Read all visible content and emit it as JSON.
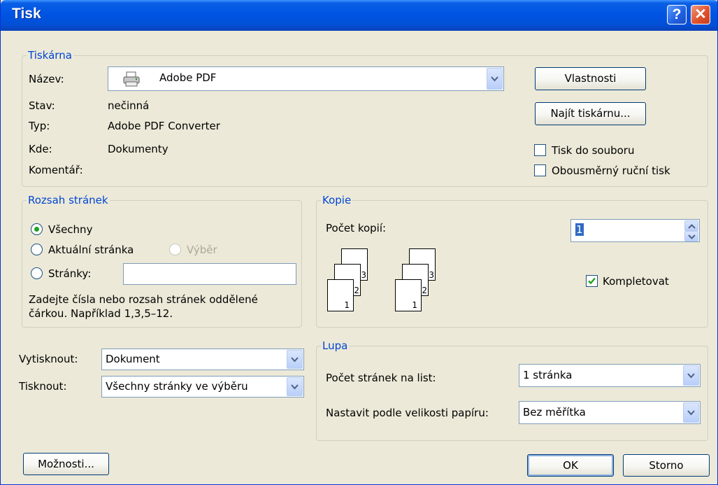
{
  "window": {
    "title": "Tisk",
    "help_label": "?",
    "close_label": "✕"
  },
  "printer": {
    "group_label": "Tiskárna",
    "name_label": "Název:",
    "name_value": "Adobe PDF",
    "status_label": "Stav:",
    "status_value": "nečinná",
    "type_label": "Typ:",
    "type_value": "Adobe PDF Converter",
    "where_label": "Kde:",
    "where_value": "Dokumenty",
    "comment_label": "Komentář:",
    "properties_button": "Vlastnosti",
    "find_printer_button": "Najít tiskárnu...",
    "print_to_file_label": "Tisk do souboru",
    "print_to_file_checked": false,
    "manual_duplex_label": "Obousměrný ruční tisk",
    "manual_duplex_checked": false
  },
  "page_range": {
    "group_label": "Rozsah stránek",
    "all_label": "Všechny",
    "current_label": "Aktuální stránka",
    "selection_label": "Výběr",
    "pages_label": "Stránky:",
    "pages_value": "",
    "selected": "all",
    "hint": "Zadejte čísla nebo rozsah stránek oddělené čárkou. Například 1,3,5–12."
  },
  "copies": {
    "group_label": "Kopie",
    "count_label": "Počet kopií:",
    "count_value": "1",
    "collate_label": "Kompletovat",
    "collate_checked": true,
    "stack_labels": [
      "1",
      "2",
      "3"
    ]
  },
  "print_what": {
    "label": "Vytisknout:",
    "value": "Dokument",
    "print_label": "Tisknout:",
    "print_value": "Všechny stránky ve výběru"
  },
  "zoom": {
    "group_label": "Lupa",
    "pages_per_sheet_label": "Počet stránek na list:",
    "pages_per_sheet_value": "1 stránka",
    "scale_label": "Nastavit podle velikosti papíru:",
    "scale_value": "Bez měřítka"
  },
  "footer": {
    "options_button": "Možnosti...",
    "ok_button": "OK",
    "cancel_button": "Storno"
  }
}
